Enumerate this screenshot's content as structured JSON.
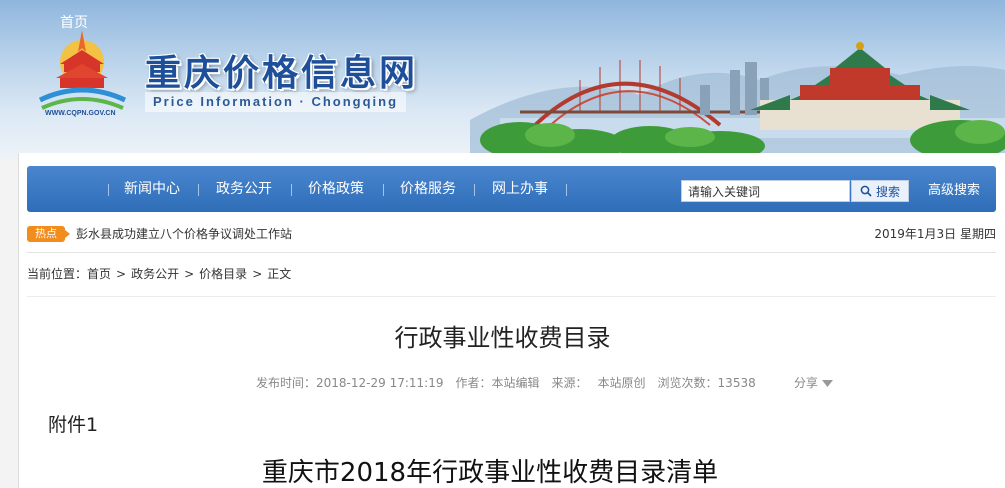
{
  "header": {
    "site_title": "重庆价格信息网",
    "site_subtitle": "Price Information · Chongqing",
    "logo_url_text": "WWW.CQPN.GOV.CN"
  },
  "nav": {
    "items": [
      {
        "label": "首页"
      },
      {
        "label": "新闻中心"
      },
      {
        "label": "政务公开"
      },
      {
        "label": "价格政策"
      },
      {
        "label": "价格服务"
      },
      {
        "label": "网上办事"
      }
    ],
    "search_value": "请输入关键词",
    "search_button": "搜索",
    "advanced_search": "高级搜索"
  },
  "hot": {
    "badge": "热点",
    "headline": "彭水县成功建立八个价格争议调处工作站",
    "date": "2019年1月3日 星期四"
  },
  "breadcrumb": {
    "label": "当前位置：",
    "items": [
      "首页",
      "政务公开",
      "价格目录",
      "正文"
    ],
    "separator": ">"
  },
  "article": {
    "title": "行政事业性收费目录",
    "meta": {
      "published_label": "发布时间：",
      "published_value": "2018-12-29 17:11:19",
      "author_label": "作者：",
      "author_value": "本站编辑",
      "source_label": "来源：",
      "source_value": "本站原创",
      "views_label": "浏览次数：",
      "views_value": "13538"
    },
    "share": "分享",
    "attachment": "附件1",
    "table_title": "重庆市2018年行政事业性收费目录清单"
  },
  "colors": {
    "nav_blue": "#2f6db8",
    "title_blue": "#1d4f9a",
    "hot_orange": "#f08d1d"
  }
}
